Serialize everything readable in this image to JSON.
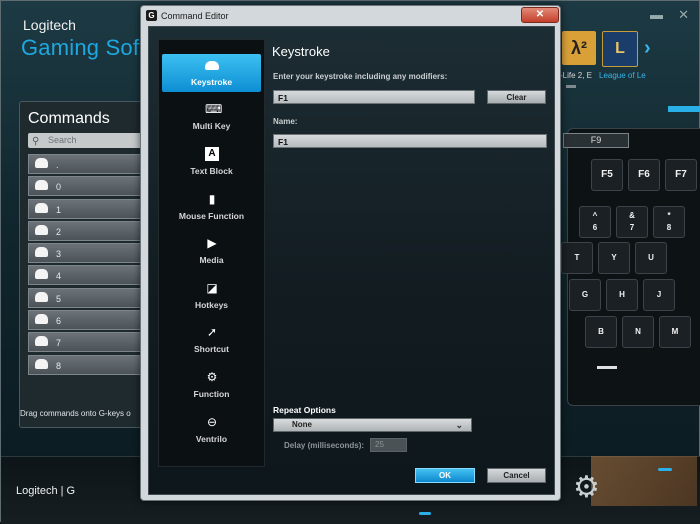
{
  "background_app": {
    "logo_small": "Logitech",
    "logo_big": "Gaming Soft",
    "commands_title": "Commands",
    "search_placeholder": "Search",
    "commands": [
      ".",
      "0",
      "1",
      "2",
      "3",
      "4",
      "5",
      "6",
      "7",
      "8"
    ],
    "drag_hint": "Drag commands onto G-keys o",
    "games": [
      {
        "icon": "λ²",
        "caption": "-Life 2, E"
      },
      {
        "icon": "L",
        "caption": "League of Le"
      }
    ],
    "keyboard": {
      "f9_label": "F9",
      "row_f": [
        "F5",
        "F6",
        "F7"
      ],
      "row_num": [
        {
          "top": "^",
          "bottom": "6"
        },
        {
          "top": "&",
          "bottom": "7"
        },
        {
          "top": "*",
          "bottom": "8"
        }
      ],
      "row_qwerty": [
        "T",
        "Y",
        "U"
      ],
      "row_asdf": [
        "G",
        "H",
        "J"
      ],
      "row_zxcv": [
        "B",
        "N",
        "M"
      ]
    },
    "bottom_logo": "Logitech | G"
  },
  "editor": {
    "window_title": "Command Editor",
    "close_label": "✕",
    "sidebar": [
      {
        "label": "Keystroke",
        "icon": "keystroke-icon",
        "active": true
      },
      {
        "label": "Multi Key",
        "icon": "multi-key-icon",
        "active": false
      },
      {
        "label": "Text Block",
        "icon": "text-block-icon",
        "active": false
      },
      {
        "label": "Mouse Function",
        "icon": "mouse-icon",
        "active": false
      },
      {
        "label": "Media",
        "icon": "media-icon",
        "active": false
      },
      {
        "label": "Hotkeys",
        "icon": "hotkeys-icon",
        "active": false
      },
      {
        "label": "Shortcut",
        "icon": "shortcut-icon",
        "active": false
      },
      {
        "label": "Function",
        "icon": "function-icon",
        "active": false
      },
      {
        "label": "Ventrilo",
        "icon": "ventrilo-icon",
        "active": false
      }
    ],
    "pane_title": "Keystroke",
    "keystroke_label": "Enter your keystroke including any modifiers:",
    "keystroke_value": "F1",
    "clear_label": "Clear",
    "name_label": "Name:",
    "name_value": "F1",
    "repeat_label": "Repeat Options",
    "repeat_value": "None",
    "delay_label": "Delay (milliseconds):",
    "delay_value": "25",
    "ok_label": "OK",
    "cancel_label": "Cancel",
    "accent": "#1a9de0"
  }
}
